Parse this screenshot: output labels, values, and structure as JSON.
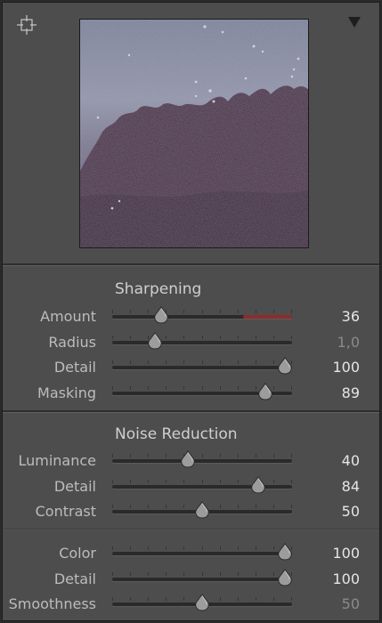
{
  "preview": {
    "alt": "Detail preview"
  },
  "sharpening": {
    "title": "Sharpening",
    "rows": [
      {
        "key": "amount",
        "label": "Amount",
        "value": "36",
        "position": 0.27,
        "dim": false,
        "red_from": 0.73
      },
      {
        "key": "radius",
        "label": "Radius",
        "value": "1,0",
        "position": 0.24,
        "dim": true
      },
      {
        "key": "detail",
        "label": "Detail",
        "value": "100",
        "position": 0.96,
        "dim": false
      },
      {
        "key": "masking",
        "label": "Masking",
        "value": "89",
        "position": 0.85,
        "dim": false
      }
    ]
  },
  "noise_reduction": {
    "title": "Noise Reduction",
    "rows": [
      {
        "key": "luminance",
        "label": "Luminance",
        "value": "40",
        "position": 0.42,
        "dim": false
      },
      {
        "key": "lum-detail",
        "label": "Detail",
        "value": "84",
        "position": 0.81,
        "dim": false
      },
      {
        "key": "contrast",
        "label": "Contrast",
        "value": "50",
        "position": 0.5,
        "dim": false
      }
    ],
    "color_rows": [
      {
        "key": "color",
        "label": "Color",
        "value": "100",
        "position": 0.96,
        "dim": false
      },
      {
        "key": "color-detail",
        "label": "Detail",
        "value": "100",
        "position": 0.96,
        "dim": false
      },
      {
        "key": "smoothness",
        "label": "Smoothness",
        "value": "50",
        "position": 0.5,
        "dim": true
      }
    ]
  },
  "icons": {
    "target": "crosshair-target-icon",
    "collapse": "triangle-down-icon"
  },
  "colors": {
    "panel": "#4d4d4d",
    "track": "#2a2a2a",
    "thumb": "#a9a9a9",
    "warning_red": "#8e2c2c"
  }
}
